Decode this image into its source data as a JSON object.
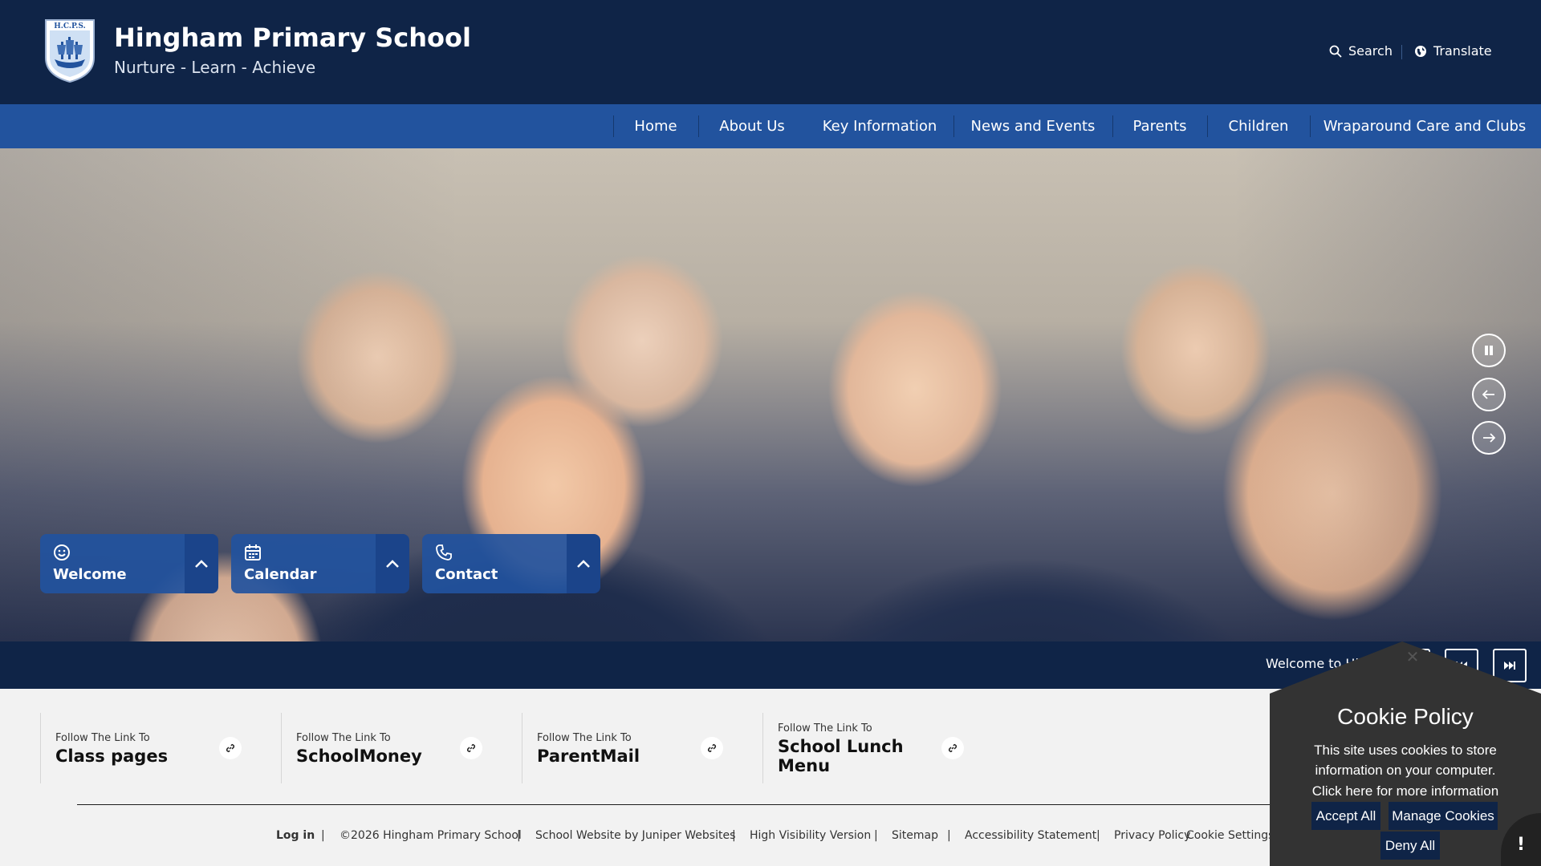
{
  "header": {
    "school_name": "Hingham Primary School",
    "motto": "Nurture - Learn - Achieve",
    "logo_text": "H.C.P.S.",
    "search_label": "Search",
    "translate_label": "Translate"
  },
  "nav": {
    "items": [
      {
        "label": "Home"
      },
      {
        "label": "About Us"
      },
      {
        "label": "Key Information"
      },
      {
        "label": "News and Events"
      },
      {
        "label": "Parents"
      },
      {
        "label": "Children"
      },
      {
        "label": "Wraparound Care and Clubs"
      }
    ]
  },
  "hero": {
    "quick_tabs": [
      {
        "label": "Welcome",
        "icon": "smile-icon"
      },
      {
        "label": "Calendar",
        "icon": "calendar-icon"
      },
      {
        "label": "Contact",
        "icon": "phone-icon"
      }
    ]
  },
  "ticker": {
    "text": "Welcome to Hingham Primary School"
  },
  "quick_links": [
    {
      "pre": "Follow The Link To",
      "title": "Class pages"
    },
    {
      "pre": "Follow The Link To",
      "title": "SchoolMoney"
    },
    {
      "pre": "Follow The Link To",
      "title": "ParentMail"
    },
    {
      "pre": "Follow The Link To",
      "title": "School Lunch Menu"
    }
  ],
  "footer": {
    "login": "Log in",
    "copyright": "©2026 Hingham Primary School",
    "credit": "School Website by Juniper Websites",
    "high_vis": "High Visibility Version",
    "sitemap": "Sitemap",
    "accessibility": "Accessibility Statement",
    "privacy": "Privacy Policy",
    "cookie_settings": "Cookie Settings",
    "separator": "|"
  },
  "cookie": {
    "title": "Cookie Policy",
    "line1": "This site uses cookies to store",
    "line2": "information on your computer.",
    "line3": "Click here for more information",
    "accept": "Accept All",
    "manage": "Manage Cookies",
    "deny": "Deny All",
    "alert": "!"
  },
  "colors": {
    "header_bg": "#0f2447",
    "nav_bg": "#22539e",
    "cookie_bg": "#333333"
  }
}
